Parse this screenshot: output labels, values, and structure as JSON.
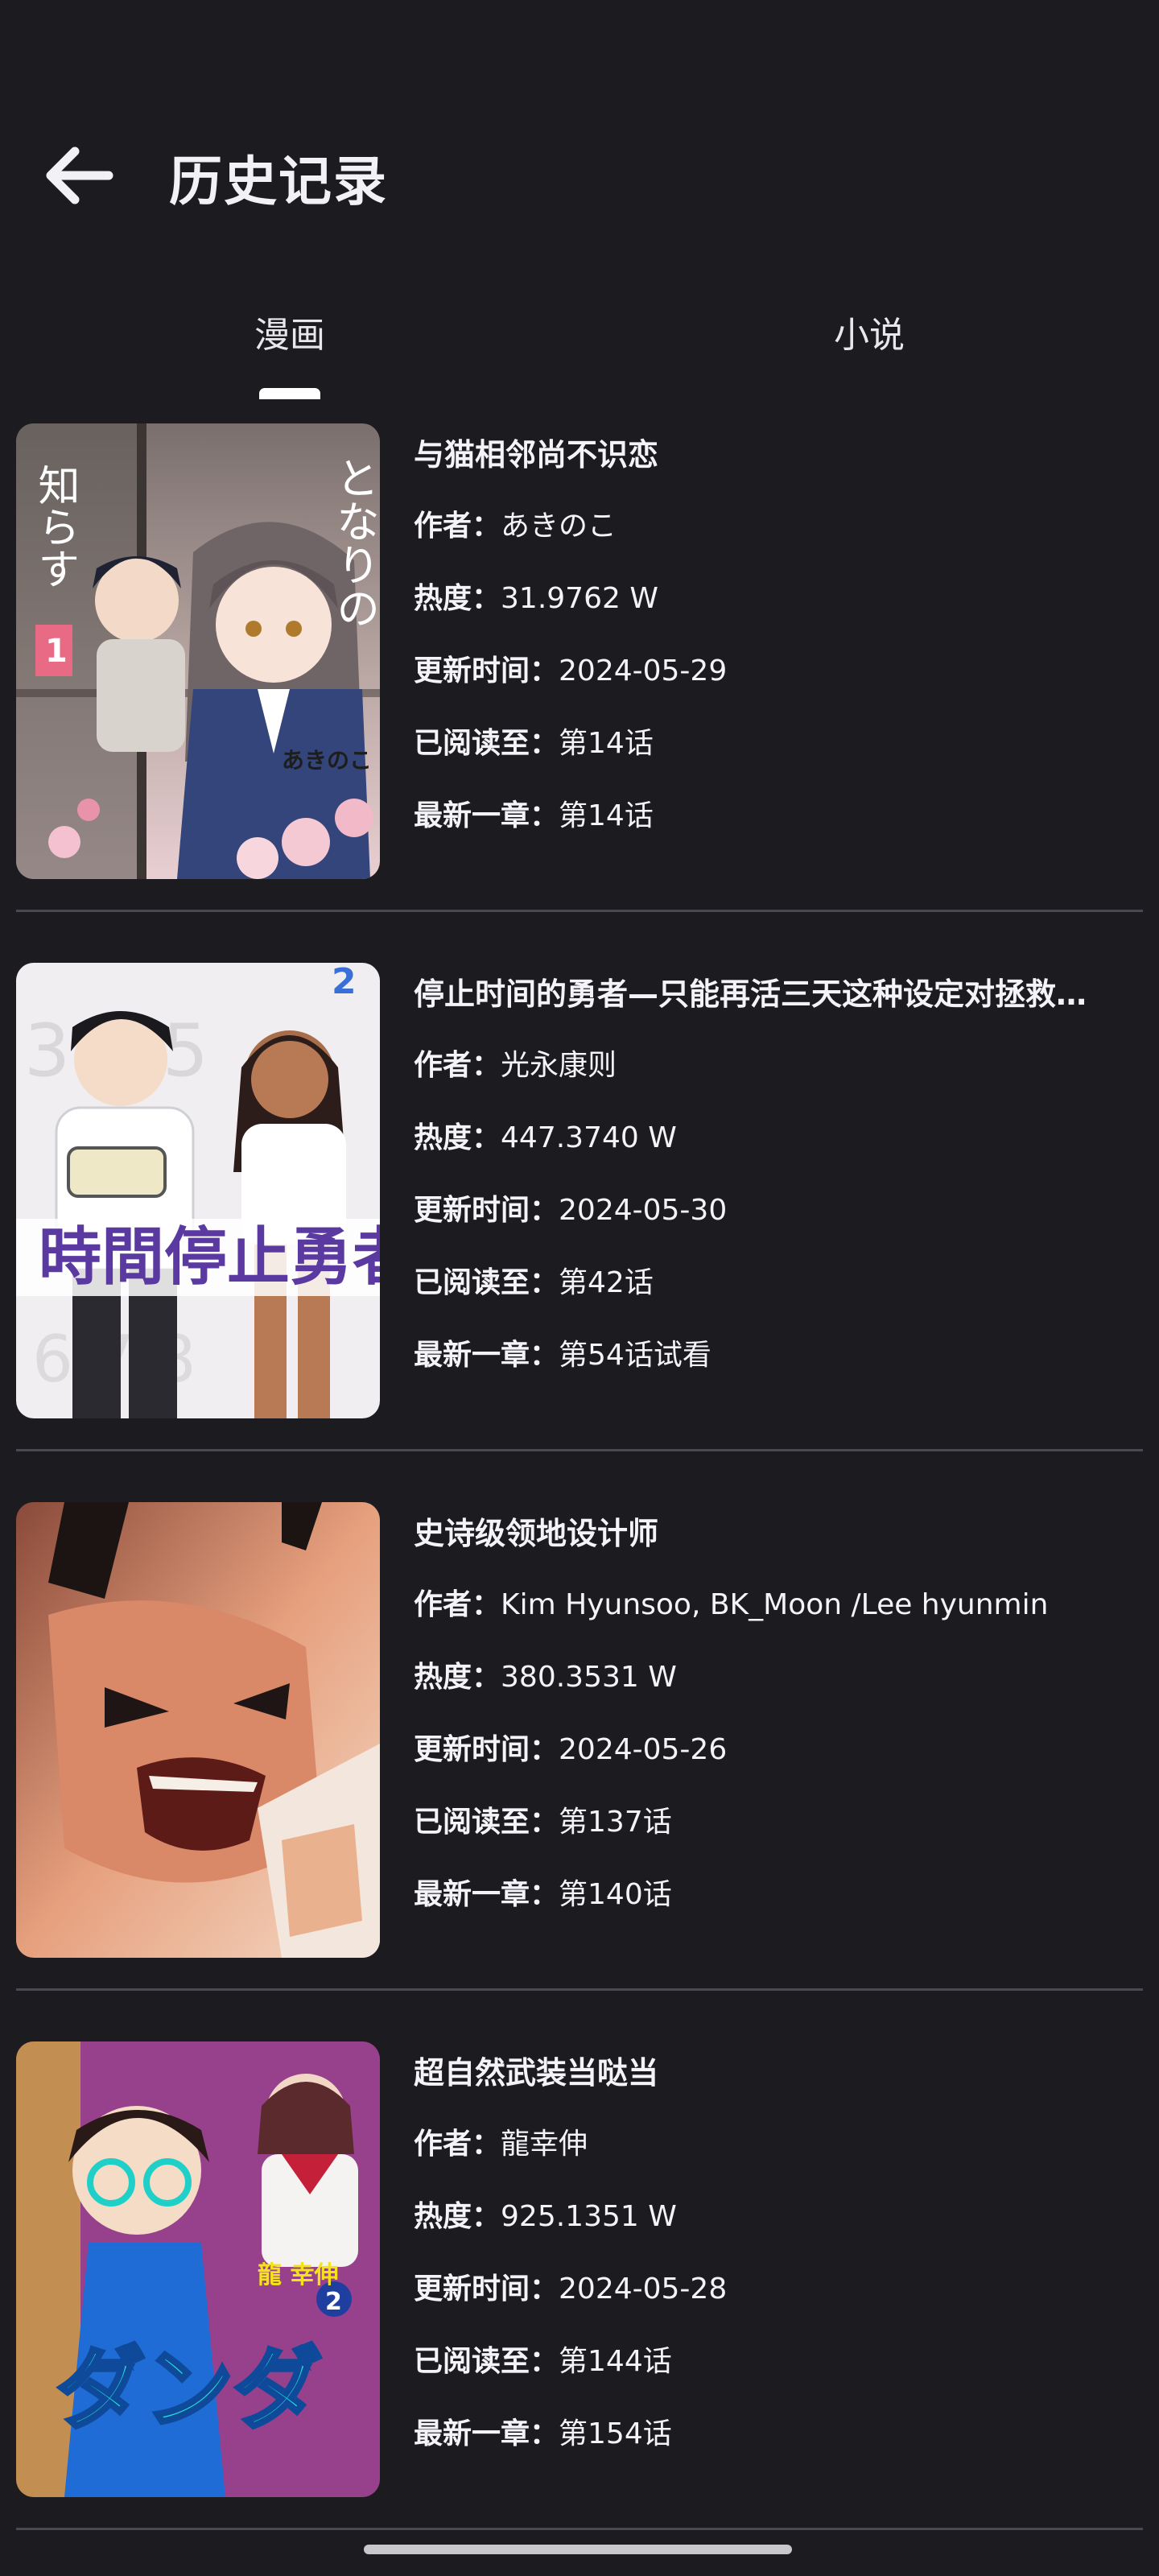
{
  "header": {
    "title": "历史记录",
    "back_icon": "arrow-left-icon"
  },
  "tabs": [
    {
      "label": "漫画",
      "selected": true
    },
    {
      "label": "小说",
      "selected": false
    }
  ],
  "labels": {
    "author": "作者：",
    "heat": "热度：",
    "updated": "更新时间：",
    "read_to": "已阅读至：",
    "latest": "最新一章："
  },
  "items": [
    {
      "title": "与猫相邻尚不识恋",
      "author": "あきのこ",
      "heat": "31.9762 W",
      "updated": "2024-05-29",
      "read_to": "第14话",
      "latest": "第14话",
      "cover_text": "となりの 知らす",
      "cover_author": "あきのこ"
    },
    {
      "title": "停止时间的勇者—只能再活三天这种设定对拯救…",
      "author": "光永康则",
      "heat": "447.3740 W",
      "updated": "2024-05-30",
      "read_to": "第42话",
      "latest": "第54话试看",
      "cover_text": "時間停止勇者"
    },
    {
      "title": "史诗级领地设计师",
      "author": "Kim Hyunsoo, BK_Moon /Lee hyunmin",
      "heat": "380.3531 W",
      "updated": "2024-05-26",
      "read_to": "第137话",
      "latest": "第140话"
    },
    {
      "title": "超自然武装当哒当",
      "author": "龍幸伸",
      "heat": "925.1351 W",
      "updated": "2024-05-28",
      "read_to": "第144话",
      "latest": "第154话",
      "cover_text": "ダンダダン",
      "cover_author": "龍 幸伸"
    }
  ],
  "colors": {
    "background": "#1c1b20",
    "text": "#f2f1f5",
    "divider": "#4a4950",
    "indicator": "#ffffff"
  }
}
